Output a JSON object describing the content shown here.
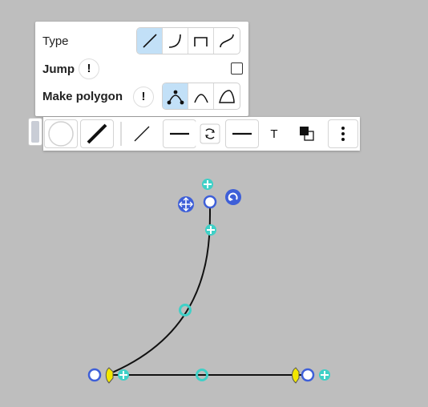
{
  "panel": {
    "type_label": "Type",
    "jump_label": "Jump",
    "polygon_label": "Make polygon",
    "warning_glyph": "!",
    "type_options": [
      "straight-line-icon",
      "curved-line-icon",
      "elbow-line-icon",
      "s-curve-line-icon"
    ],
    "type_selected": "straight-line-icon",
    "jump_checked": false,
    "polygon_options": [
      "polygon-points-icon",
      "polygon-curve-icon",
      "polygon-closed-icon"
    ],
    "polygon_selected": "polygon-points-icon",
    "accent_color": "#c2e0f7"
  },
  "toolbar": {
    "text_tool_label": "T",
    "tools": [
      "fill-color-icon",
      "stroke-width-icon",
      "line-style-icon",
      "line-weight-icon",
      "rotate-icon",
      "line-end-icon",
      "text-icon",
      "arrange-icon",
      "more-icon"
    ]
  },
  "canvas": {
    "handle_color": "#3e5fd8",
    "midpoint_color": "#3fd0c7",
    "arrow_marker_color": "#f2e700"
  }
}
